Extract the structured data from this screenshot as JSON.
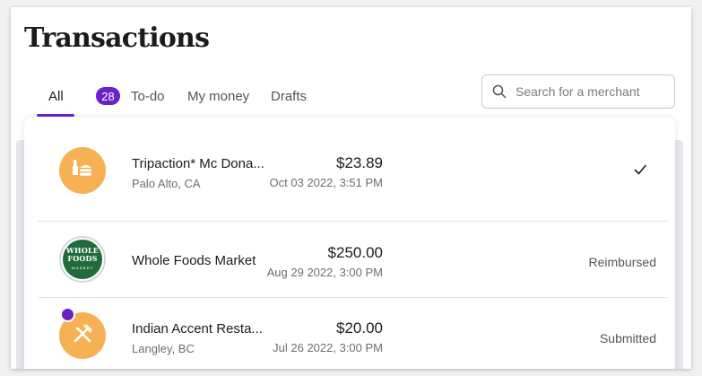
{
  "header": {
    "title": "Transactions"
  },
  "tabs": [
    {
      "label": "All",
      "active": true
    },
    {
      "label": "To-do",
      "badge": "28"
    },
    {
      "label": "My money"
    },
    {
      "label": "Drafts"
    }
  ],
  "search": {
    "placeholder": "Search for a merchant",
    "icon": "search-icon"
  },
  "colors": {
    "accent": "#6b21c8",
    "avatar_orange": "#f5b154",
    "whole_foods_green": "#1f6b3b"
  },
  "transactions": [
    {
      "merchant": "Tripaction* Mc Dona...",
      "location": "Palo Alto, CA",
      "amount": "$23.89",
      "date": "Oct 03 2022, 3:51 PM",
      "status": "",
      "status_icon": "checkmark-icon",
      "avatar_icon": "fast-food-icon"
    },
    {
      "merchant": "Whole Foods Market",
      "location": "",
      "amount": "$250.00",
      "date": "Aug 29 2022, 3:00 PM",
      "status": "Reimbursed",
      "avatar_logo": {
        "line1": "WHOLE",
        "line2": "FOODS",
        "line3": "MARKET"
      }
    },
    {
      "merchant": "Indian Accent Resta...",
      "location": "Langley, BC",
      "amount": "$20.00",
      "date": "Jul 26 2022, 3:00 PM",
      "status": "Submitted",
      "avatar_icon": "fork-knife-icon",
      "unread_dot": true
    }
  ]
}
